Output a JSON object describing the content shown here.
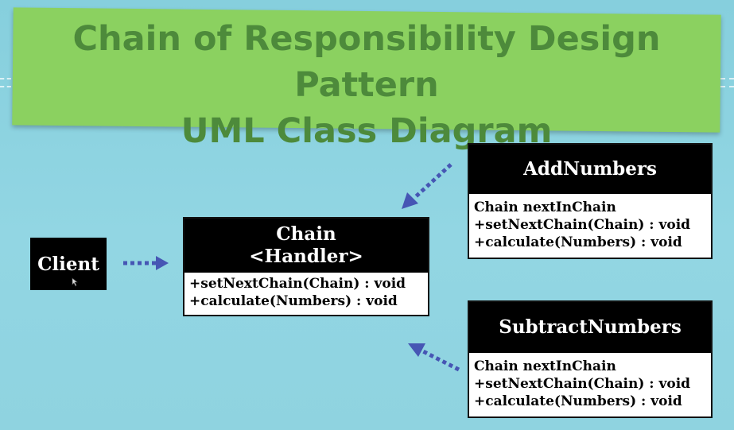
{
  "title": {
    "line1": "Chain of Responsibility Design Pattern",
    "line2": "UML Class Diagram"
  },
  "client": {
    "label": "Client"
  },
  "chain": {
    "name": "Chain",
    "stereotype": "<Handler>",
    "methods": [
      "+setNextChain(Chain) : void",
      "+calculate(Numbers) : void"
    ]
  },
  "add_numbers": {
    "name": "AddNumbers",
    "attributes": [
      "Chain nextInChain"
    ],
    "methods": [
      "+setNextChain(Chain) : void",
      "+calculate(Numbers) : void"
    ]
  },
  "subtract_numbers": {
    "name": "SubtractNumbers",
    "attributes": [
      "Chain nextInChain"
    ],
    "methods": [
      "+setNextChain(Chain) : void",
      "+calculate(Numbers) : void"
    ]
  },
  "colors": {
    "background": "#8ed3e1",
    "banner": "#8bd160",
    "banner_text": "#4d8a3b",
    "arrow": "#4656b4"
  }
}
